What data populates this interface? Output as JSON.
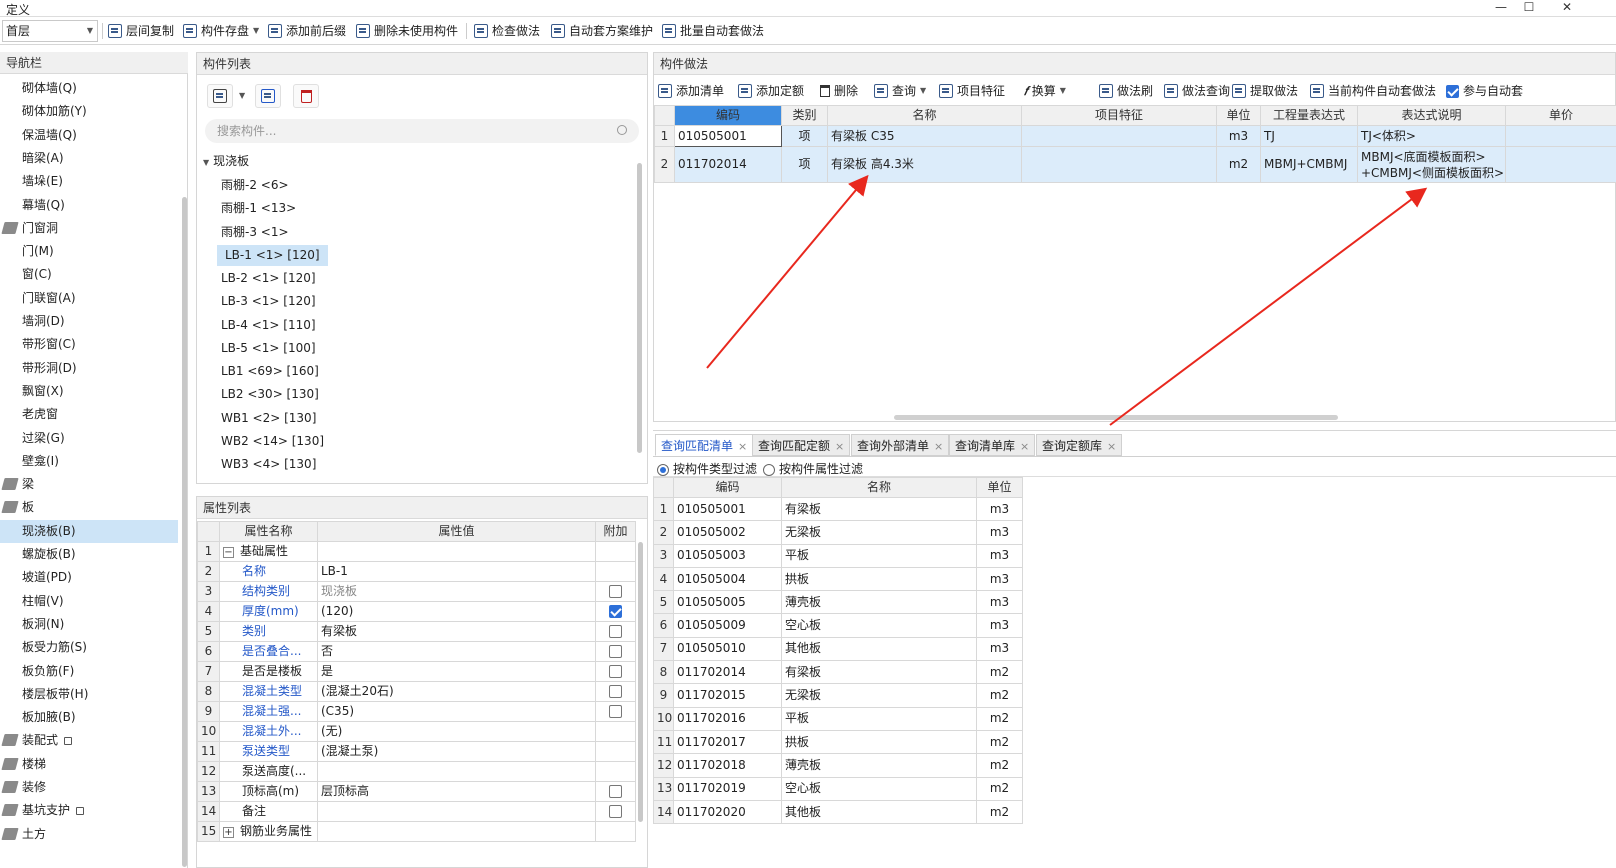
{
  "title": "定义",
  "window_buttons": [
    "—",
    "☐",
    "✕"
  ],
  "floor_select": "首层",
  "toolbar": [
    "层间复制",
    "构件存盘",
    "添加前后缀",
    "删除未使用构件",
    "检查做法",
    "自动套方案维护",
    "批量自动套做法"
  ],
  "nav": {
    "title": "导航栏",
    "items": [
      {
        "label": "砌体墙(Q)",
        "type": "sub"
      },
      {
        "label": "砌体加筋(Y)",
        "type": "sub"
      },
      {
        "label": "保温墙(Q)",
        "type": "sub"
      },
      {
        "label": "暗梁(A)",
        "type": "sub"
      },
      {
        "label": "墙垛(E)",
        "type": "sub"
      },
      {
        "label": "幕墙(Q)",
        "type": "sub"
      },
      {
        "label": "门窗洞",
        "type": "grp"
      },
      {
        "label": "门(M)",
        "type": "sub"
      },
      {
        "label": "窗(C)",
        "type": "sub"
      },
      {
        "label": "门联窗(A)",
        "type": "sub"
      },
      {
        "label": "墙洞(D)",
        "type": "sub"
      },
      {
        "label": "带形窗(C)",
        "type": "sub"
      },
      {
        "label": "带形洞(D)",
        "type": "sub"
      },
      {
        "label": "飘窗(X)",
        "type": "sub"
      },
      {
        "label": "老虎窗",
        "type": "sub"
      },
      {
        "label": "过梁(G)",
        "type": "sub"
      },
      {
        "label": "壁龛(I)",
        "type": "sub"
      },
      {
        "label": "梁",
        "type": "grp"
      },
      {
        "label": "板",
        "type": "grp"
      },
      {
        "label": "现浇板(B)",
        "type": "sub",
        "selected": true
      },
      {
        "label": "螺旋板(B)",
        "type": "sub"
      },
      {
        "label": "坡道(PD)",
        "type": "sub"
      },
      {
        "label": "柱帽(V)",
        "type": "sub"
      },
      {
        "label": "板洞(N)",
        "type": "sub"
      },
      {
        "label": "板受力筋(S)",
        "type": "sub"
      },
      {
        "label": "板负筋(F)",
        "type": "sub"
      },
      {
        "label": "楼层板带(H)",
        "type": "sub"
      },
      {
        "label": "板加腋(B)",
        "type": "sub"
      },
      {
        "label": "装配式",
        "type": "grp",
        "lock": true
      },
      {
        "label": "楼梯",
        "type": "grp"
      },
      {
        "label": "装修",
        "type": "grp"
      },
      {
        "label": "基坑支护",
        "type": "grp",
        "lock": true
      },
      {
        "label": "土方",
        "type": "grp"
      }
    ]
  },
  "complist": {
    "title": "构件列表",
    "search_placeholder": "搜索构件...",
    "root": "现浇板",
    "items": [
      "雨棚-2 <6>",
      "雨棚-1 <13>",
      "雨棚-3 <1>",
      "LB-1 <1> [120]",
      "LB-2 <1> [120]",
      "LB-3 <1> [120]",
      "LB-4 <1> [110]",
      "LB-5 <1> [100]",
      "LB1 <69> [160]",
      "LB2 <30> [130]",
      "WB1 <2> [130]",
      "WB2 <14> [130]",
      "WB3 <4> [130]"
    ],
    "selected_index": 3
  },
  "props": {
    "title": "属性列表",
    "headers": [
      "属性名称",
      "属性值",
      "附加"
    ],
    "rows": [
      {
        "n": "1",
        "name": "基础属性",
        "value": "",
        "cb": "",
        "kind": "group",
        "sign": "−"
      },
      {
        "n": "2",
        "name": "名称",
        "value": "LB-1",
        "cb": "",
        "kind": "blue"
      },
      {
        "n": "3",
        "name": "结构类别",
        "value": "现浇板",
        "cb": "off",
        "kind": "blue",
        "vgray": true
      },
      {
        "n": "4",
        "name": "厚度(mm)",
        "value": "(120)",
        "cb": "on",
        "kind": "blue"
      },
      {
        "n": "5",
        "name": "类别",
        "value": "有梁板",
        "cb": "off",
        "kind": "blue"
      },
      {
        "n": "6",
        "name": "是否叠合...",
        "value": "否",
        "cb": "off",
        "kind": "blue"
      },
      {
        "n": "7",
        "name": "是否是楼板",
        "value": "是",
        "cb": "off",
        "kind": "plain"
      },
      {
        "n": "8",
        "name": "混凝土类型",
        "value": "(混凝土20石)",
        "cb": "off",
        "kind": "blue"
      },
      {
        "n": "9",
        "name": "混凝土强...",
        "value": "(C35)",
        "cb": "off",
        "kind": "blue"
      },
      {
        "n": "10",
        "name": "混凝土外...",
        "value": "(无)",
        "cb": "",
        "kind": "blue"
      },
      {
        "n": "11",
        "name": "泵送类型",
        "value": "(混凝土泵)",
        "cb": "",
        "kind": "blue"
      },
      {
        "n": "12",
        "name": "泵送高度(...",
        "value": "",
        "cb": "",
        "kind": "plain"
      },
      {
        "n": "13",
        "name": "顶标高(m)",
        "value": "层顶标高",
        "cb": "off",
        "kind": "plain"
      },
      {
        "n": "14",
        "name": "备注",
        "value": "",
        "cb": "off",
        "kind": "plain"
      },
      {
        "n": "15",
        "name": "钢筋业务属性",
        "value": "",
        "cb": "",
        "kind": "group",
        "sign": "+"
      }
    ]
  },
  "method": {
    "title": "构件做法",
    "toolbar": [
      "添加清单",
      "添加定额",
      "删除",
      "查询",
      "项目特征",
      "换算",
      "做法刷",
      "做法查询",
      "提取做法",
      "当前构件自动套做法",
      "参与自动套"
    ],
    "headers": [
      "编码",
      "类别",
      "名称",
      "项目特征",
      "单位",
      "工程量表达式",
      "表达式说明",
      "单价"
    ],
    "rows": [
      {
        "n": "1",
        "code": "010505001",
        "cat": "项",
        "name": "有梁板 C35",
        "feat": "",
        "unit": "m3",
        "expr": "TJ",
        "desc": "TJ<体积>",
        "price": ""
      },
      {
        "n": "2",
        "code": "011702014",
        "cat": "项",
        "name": "有梁板 高4.3米",
        "feat": "",
        "unit": "m2",
        "expr": "MBMJ+CMBMJ",
        "desc": "MBMJ<底面模板面积>",
        "desc2": "+CMBMJ<侧面模板面积>",
        "price": ""
      }
    ]
  },
  "query": {
    "tabs": [
      "查询匹配清单",
      "查询匹配定额",
      "查询外部清单",
      "查询清单库",
      "查询定额库"
    ],
    "filters": [
      "按构件类型过滤",
      "按构件属性过滤"
    ],
    "headers": [
      "编码",
      "名称",
      "单位"
    ],
    "rows": [
      [
        "1",
        "010505001",
        "有梁板",
        "m3"
      ],
      [
        "2",
        "010505002",
        "无梁板",
        "m3"
      ],
      [
        "3",
        "010505003",
        "平板",
        "m3"
      ],
      [
        "4",
        "010505004",
        "拱板",
        "m3"
      ],
      [
        "5",
        "010505005",
        "薄壳板",
        "m3"
      ],
      [
        "6",
        "010505009",
        "空心板",
        "m3"
      ],
      [
        "7",
        "010505010",
        "其他板",
        "m3"
      ],
      [
        "8",
        "011702014",
        "有梁板",
        "m2"
      ],
      [
        "9",
        "011702015",
        "无梁板",
        "m2"
      ],
      [
        "10",
        "011702016",
        "平板",
        "m2"
      ],
      [
        "11",
        "011702017",
        "拱板",
        "m2"
      ],
      [
        "12",
        "011702018",
        "薄壳板",
        "m2"
      ],
      [
        "13",
        "011702019",
        "空心板",
        "m2"
      ],
      [
        "14",
        "011702020",
        "其他板",
        "m2"
      ]
    ]
  },
  "colors": {
    "accent": "#2458c8",
    "selection": "#cde4f7",
    "arrow": "#e8281e"
  }
}
